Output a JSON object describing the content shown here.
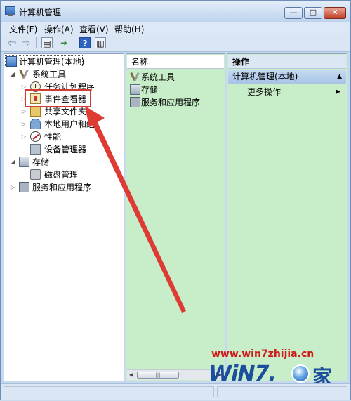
{
  "window": {
    "title": "计算机管理",
    "buttons": {
      "minimize": "—",
      "maximize": "□",
      "close": "✕"
    }
  },
  "menubar": {
    "items": [
      "文件(F)",
      "操作(A)",
      "查看(V)",
      "帮助(H)"
    ]
  },
  "toolbar": {
    "back_icon": "arrow-left-icon",
    "forward_icon": "arrow-right-icon",
    "help_glyph": "?"
  },
  "tree": {
    "root": "计算机管理(本地)",
    "items": [
      {
        "label": "系统工具",
        "icon": "tools-icon",
        "expander": "◢"
      },
      {
        "label": "任务计划程序",
        "icon": "clock-icon",
        "expander": "▷"
      },
      {
        "label": "事件查看器",
        "icon": "event-viewer-icon",
        "expander": "▷"
      },
      {
        "label": "共享文件夹",
        "icon": "shared-folder-icon",
        "expander": "▷"
      },
      {
        "label": "本地用户和组",
        "icon": "users-icon",
        "expander": "▷"
      },
      {
        "label": "性能",
        "icon": "performance-icon",
        "expander": "▷"
      },
      {
        "label": "设备管理器",
        "icon": "device-manager-icon",
        "expander": ""
      },
      {
        "label": "存储",
        "icon": "storage-icon",
        "expander": "◢"
      },
      {
        "label": "磁盘管理",
        "icon": "disk-icon",
        "expander": ""
      },
      {
        "label": "服务和应用程序",
        "icon": "services-icon",
        "expander": "▷"
      }
    ]
  },
  "middle": {
    "column_header": "名称",
    "items": [
      "系统工具",
      "存储",
      "服务和应用程序"
    ],
    "scroll_thumb_grip": "|||"
  },
  "actions": {
    "header": "操作",
    "section_title": "计算机管理(本地)",
    "items": [
      "更多操作"
    ]
  },
  "watermark": {
    "url": "www.win7zhijia.cn",
    "logo_text": "WiN7.",
    "logo_char": "家"
  },
  "colors": {
    "highlight_box": "#d23c32",
    "arrow": "#dd3b33",
    "pane_background": "#c7eec8"
  }
}
